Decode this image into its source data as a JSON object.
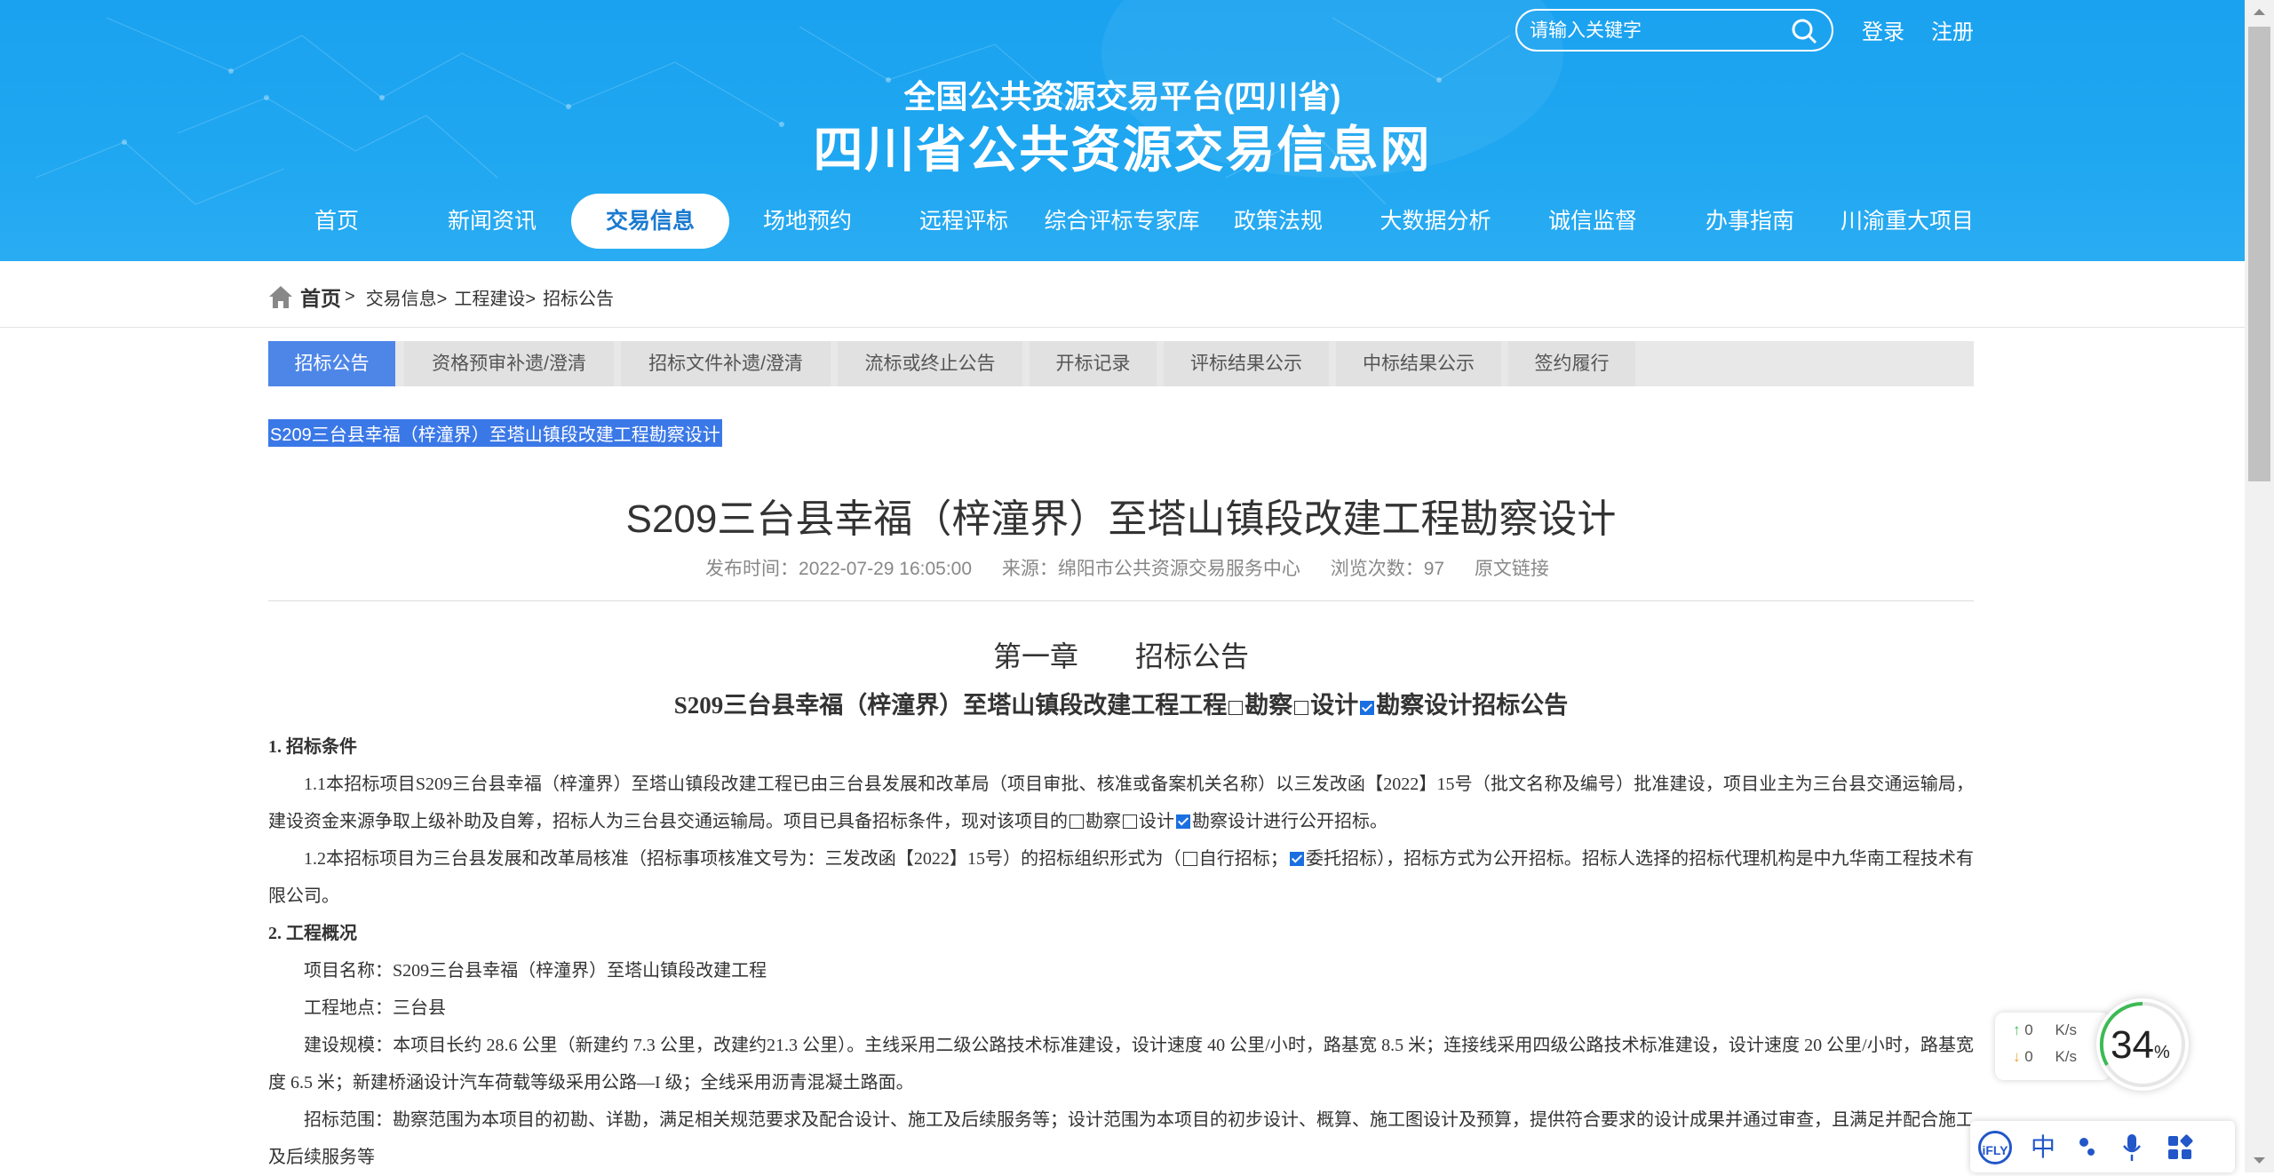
{
  "header": {
    "platform_title": "全国公共资源交易平台(四川省)",
    "site_title": "四川省公共资源交易信息网",
    "search_placeholder": "请输入关键字",
    "login": "登录",
    "register": "注册"
  },
  "nav": [
    "首页",
    "新闻资讯",
    "交易信息",
    "场地预约",
    "远程评标",
    "综合评标专家库",
    "政策法规",
    "大数据分析",
    "诚信监督",
    "办事指南",
    "川渝重大项目"
  ],
  "nav_active": "交易信息",
  "breadcrumb": {
    "home": "首页",
    "items": [
      "交易信息>",
      "工程建设>",
      "招标公告"
    ],
    "sep": ">"
  },
  "tabs": [
    "招标公告",
    "资格预审补遗/澄清",
    "招标文件补遗/澄清",
    "流标或终止公告",
    "开标记录",
    "评标结果公示",
    "中标结果公示",
    "签约履行"
  ],
  "tab_active": "招标公告",
  "selected_text": "S209三台县幸福（梓潼界）至塔山镇段改建工程勘察设计",
  "article": {
    "title": "S209三台县幸福（梓潼界）至塔山镇段改建工程勘察设计",
    "publish_time": "发布时间：2022-07-29 16:05:00",
    "source": "来源：绵阳市公共资源交易服务中心",
    "views": "浏览次数：97",
    "original_link": "原文链接",
    "chapter": "第一章　　招标公告",
    "subtitle_a": "S209三台县幸福（梓潼界）至塔山镇段改建工程工程",
    "subtitle_b": "勘察",
    "subtitle_c": "设计",
    "subtitle_d": "勘察设计招标公告",
    "s1_heading": "1. 招标条件",
    "p1_a": "1.1本招标项目S209三台县幸福（梓潼界）至塔山镇段改建工程已由三台县发展和改革局（项目审批、核准或备案机关名称）以三发改函【2022】15号（批文名称及编号）批准建设，项目业主为三台县交通运输局，建设资金来源争取上级补助及自筹，招标人为三台县交通运输局。项目已具备招标条件，现对该项目的",
    "p1_b": "勘察",
    "p1_c": "设计",
    "p1_d": "勘察设计进行公开招标。",
    "p2_a": "1.2本招标项目为三台县发展和改革局核准（招标事项核准文号为：三发改函【2022】15号）的招标组织形式为（",
    "p2_b": "自行招标；",
    "p2_c": "委托招标），招标方式为公开招标。招标人选择的招标代理机构是中九华南工程技术有限公司。",
    "s2_heading": "2. 工程概况",
    "p3": "项目名称：S209三台县幸福（梓潼界）至塔山镇段改建工程",
    "p4": "工程地点：三台县",
    "p5": "建设规模：本项目长约 28.6 公里（新建约 7.3 公里，改建约21.3 公里）。主线采用二级公路技术标准建设，设计速度 40 公里/小时，路基宽 8.5 米；连接线采用四级公路技术标准建设，设计速度 20 公里/小时，路基宽度 6.5 米；新建桥涵设计汽车荷载等级采用公路—I 级；全线采用沥青混凝土路面。",
    "p6": "招标范围：勘察范围为本项目的初勘、详勘，满足相关规范要求及配合设计、施工及后续服务等；设计范围为本项目的初步设计、概算、施工图设计及预算，提供符合要求的设计成果并通过审查，且满足并配合施工及后续服务等"
  },
  "widgets": {
    "upload_speed": "0",
    "download_speed": "0",
    "speed_unit": "K/s",
    "percent": "34",
    "percent_unit": "%",
    "ime_logo": "iFLY",
    "ime_lang": "中"
  }
}
